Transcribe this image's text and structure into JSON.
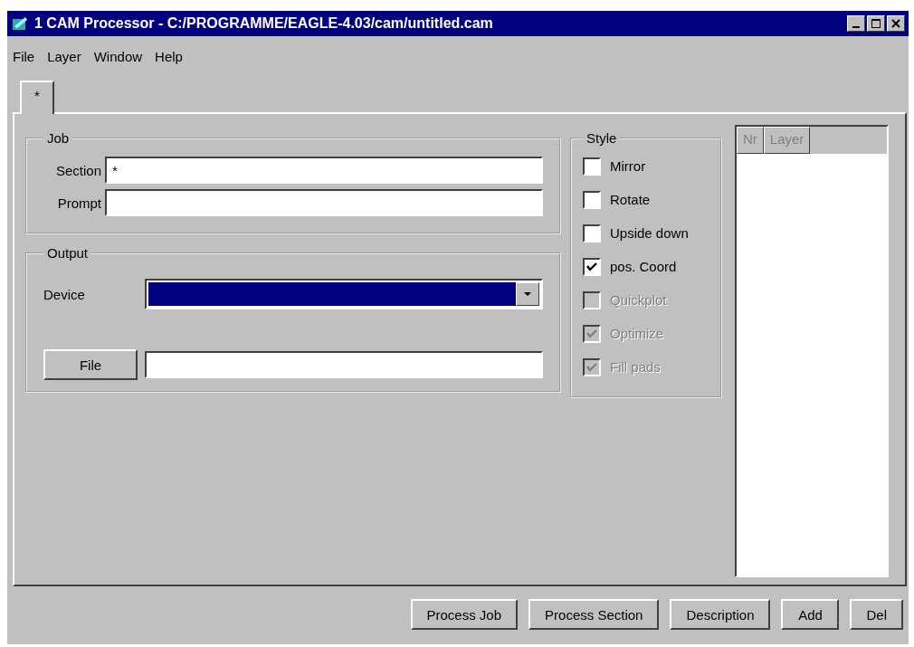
{
  "window": {
    "title": "1 CAM Processor - C:/PROGRAMME/EAGLE-4.03/cam/untitled.cam"
  },
  "menu": [
    "File",
    "Layer",
    "Window",
    "Help"
  ],
  "tabs": [
    {
      "label": "*",
      "selected": true
    }
  ],
  "job": {
    "title": "Job",
    "section": {
      "label": "Section",
      "value": "*"
    },
    "prompt": {
      "label": "Prompt"
    }
  },
  "output": {
    "title": "Output",
    "device": {
      "label": "Device",
      "selected": true
    },
    "file_button": "File"
  },
  "style": {
    "title": "Style",
    "options": [
      {
        "label": "Mirror",
        "checked": false,
        "disabled": false
      },
      {
        "label": "Rotate",
        "checked": false,
        "disabled": false
      },
      {
        "label": "Upside down",
        "checked": false,
        "disabled": false
      },
      {
        "label": "pos. Coord",
        "checked": true,
        "disabled": false
      },
      {
        "label": "Quickplot",
        "checked": false,
        "disabled": true
      },
      {
        "label": "Optimize",
        "checked": true,
        "disabled": true
      },
      {
        "label": "Fill pads",
        "checked": true,
        "disabled": true
      }
    ]
  },
  "layers": {
    "columns": [
      "Nr",
      "Layer"
    ]
  },
  "buttons": [
    "Process Job",
    "Process Section",
    "Description",
    "Add",
    "Del"
  ]
}
